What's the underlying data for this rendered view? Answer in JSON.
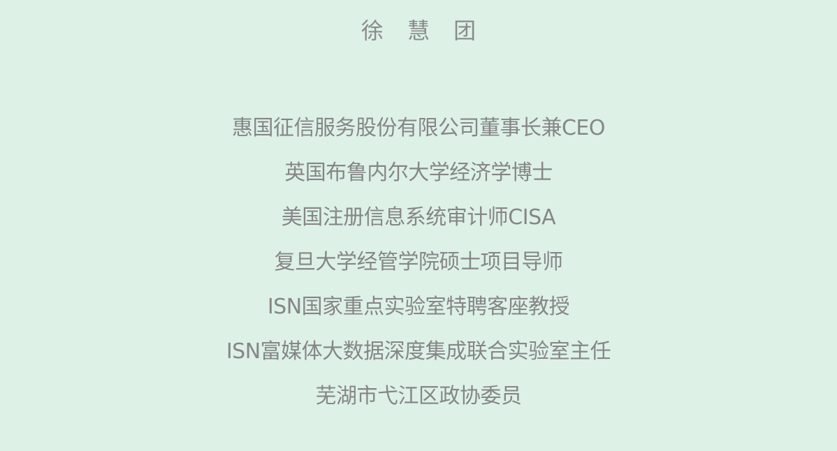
{
  "profile": {
    "name": "徐 慧 团",
    "titles": [
      "惠国征信服务股份有限公司董事长兼CEO",
      "英国布鲁内尔大学经济学博士",
      "美国注册信息系统审计师CISA",
      "复旦大学经管学院硕士项目导师",
      "ISN国家重点实验室特聘客座教授",
      "ISN富媒体大数据深度集成联合实验室主任",
      "芜湖市弋江区政协委员"
    ]
  },
  "colors": {
    "background": "#ddf1e7",
    "text": "#868686"
  }
}
